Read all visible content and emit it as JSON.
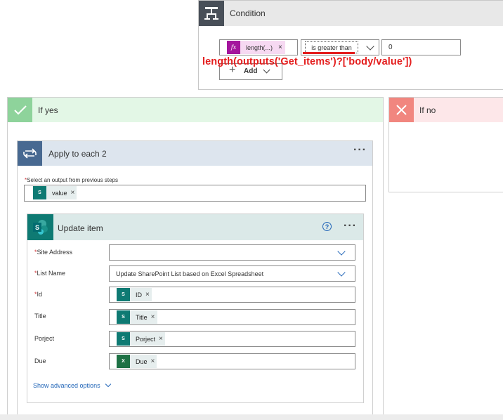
{
  "condition": {
    "title": "Condition",
    "left_operand": "length(...)",
    "operator": "is greater than",
    "right_operand": "0",
    "add_label": "Add"
  },
  "annotation": "length(outputs('Get_items')?['body/value'])",
  "if_yes": {
    "title": "If yes"
  },
  "if_no": {
    "title": "If no"
  },
  "apply_each": {
    "title": "Apply to each 2",
    "select_label": "Select an output from previous steps",
    "token": "value"
  },
  "update_item": {
    "title": "Update item",
    "fields": {
      "site_address": {
        "label": "Site Address",
        "value": ""
      },
      "list_name": {
        "label": "List Name",
        "value": "Update SharePoint List based on Excel Spreadsheet"
      },
      "id": {
        "label": "Id",
        "token": "ID"
      },
      "title": {
        "label": "Title",
        "token": "Title"
      },
      "project": {
        "label": "Porject",
        "token": "Porject"
      },
      "due": {
        "label": "Due",
        "token": "Due"
      }
    },
    "advanced_link": "Show advanced options"
  },
  "colors": {
    "condition_icon_bg": "#484f58",
    "yes_bg": "#e3f7e6",
    "yes_icon_bg": "#8ed39b",
    "no_bg": "#fde7e9",
    "no_icon_bg": "#f1867f",
    "apply_icon_bg": "#486991",
    "sharepoint_teal": "#0e7a73",
    "excel_green": "#1e7145",
    "expression_magenta": "#a4159d",
    "annotation_red": "#e41e1e",
    "link_blue": "#2266b8"
  },
  "icons": {
    "condition": "condition-branch-icon",
    "yes": "check-icon",
    "no": "close-icon",
    "apply": "loop-icon",
    "sharepoint": "sharepoint-icon",
    "excel": "excel-icon",
    "help": "help-circle-icon",
    "more": "more-ellipsis-icon"
  }
}
